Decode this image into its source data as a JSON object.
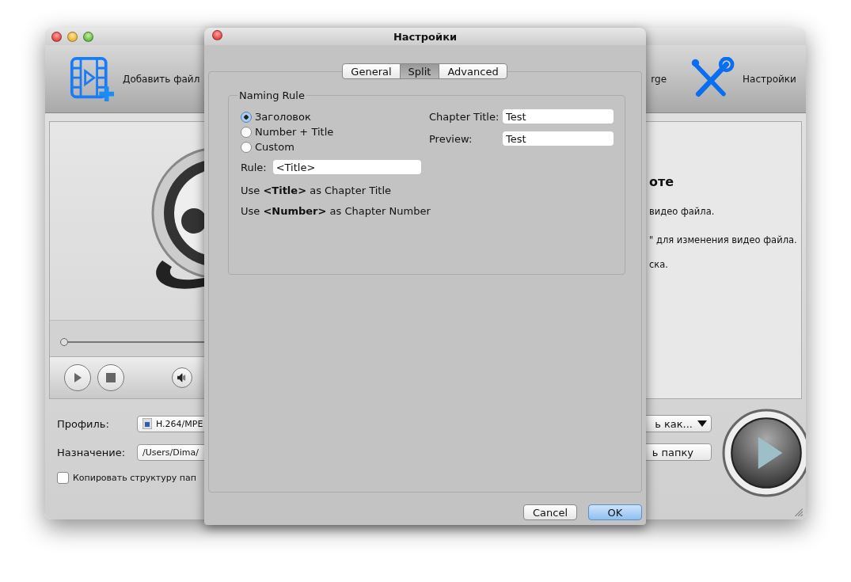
{
  "toolbar": [
    {
      "kind": "add",
      "label": "Добавить файл"
    },
    {
      "kind": "fragment",
      "label": "rge"
    },
    {
      "kind": "settings",
      "label": "Настройки"
    }
  ],
  "player": {
    "seek": {
      "level": 0
    }
  },
  "guide": {
    "title": "оте",
    "steps": [
      "видео файла.",
      "\" для изменения видео файла.",
      "ска."
    ]
  },
  "output": {
    "profile_label": "Профиль:",
    "profile": "H.264/MPE",
    "save_as_button": "ь как...",
    "destination_label": "Назначение:",
    "destination": "/Users/Dima/",
    "open_folder_button": "ь папку",
    "copy_structure": {
      "label": "Копировать структуру пап",
      "checked": false
    }
  },
  "dialog": {
    "title": "Настройки",
    "tabs": [
      {
        "label": "General",
        "selected": false
      },
      {
        "label": "Split",
        "selected": true
      },
      {
        "label": "Advanced",
        "selected": false
      }
    ],
    "group_title": "Naming Rule",
    "options": [
      {
        "label": "Заголовок",
        "selected": true
      },
      {
        "label": "Number + Title",
        "selected": false
      },
      {
        "label": "Custom",
        "selected": false
      }
    ],
    "rule_label": "Rule:",
    "rule_value": "<Title>",
    "notes": [
      "Use **<Title>** as Chapter Title",
      "Use **<Number>** as Chapter Number"
    ],
    "fields": [
      {
        "label": "Chapter Title:",
        "value": "Test"
      },
      {
        "label": "Preview:",
        "value": "Test"
      }
    ],
    "buttons": [
      {
        "kind": "cancel",
        "label": "Cancel"
      },
      {
        "kind": "default",
        "label": "OK"
      }
    ]
  }
}
